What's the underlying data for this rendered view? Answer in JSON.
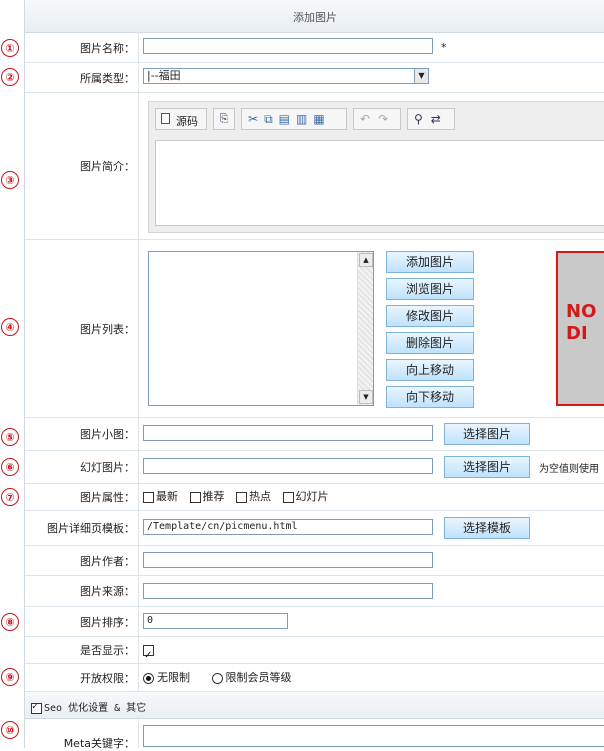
{
  "header": {
    "title": "添加图片"
  },
  "markers": [
    "①",
    "②",
    "③",
    "④",
    "⑤",
    "⑥",
    "⑦",
    "⑧",
    "⑨",
    "⑩"
  ],
  "fields": {
    "name": {
      "label": "图片名称：",
      "value": "",
      "required_mark": "*"
    },
    "type": {
      "label": "所属类型：",
      "selected": "|--福田"
    },
    "intro": {
      "label": "图片简介：",
      "toolbar_source": "源码"
    },
    "list": {
      "label": "图片列表：",
      "buttons": [
        "添加图片",
        "浏览图片",
        "修改图片",
        "删除图片",
        "向上移动",
        "向下移动"
      ],
      "preview_text": "NO\nDI"
    },
    "thumb": {
      "label": "图片小图：",
      "value": "",
      "button": "选择图片"
    },
    "slide": {
      "label": "幻灯图片：",
      "value": "",
      "button": "选择图片",
      "hint": "为空值则使用"
    },
    "attrs": {
      "label": "图片属性：",
      "options": [
        "最新",
        "推荐",
        "热点",
        "幻灯片"
      ]
    },
    "template": {
      "label": "图片详细页模板：",
      "value": "/Template/cn/picmenu.html",
      "button": "选择模板"
    },
    "author": {
      "label": "图片作者：",
      "value": ""
    },
    "source": {
      "label": "图片来源：",
      "value": ""
    },
    "sort": {
      "label": "图片排序：",
      "value": "0"
    },
    "show": {
      "label": "是否显示：",
      "checked": true
    },
    "perm": {
      "label": "开放权限：",
      "options": [
        "无限制",
        "限制会员等级"
      ],
      "selected": "无限制"
    },
    "seo": {
      "label": "Seo 优化设置 & 其它",
      "checked": true
    },
    "meta": {
      "label": "Meta关键字：",
      "value": ""
    }
  }
}
